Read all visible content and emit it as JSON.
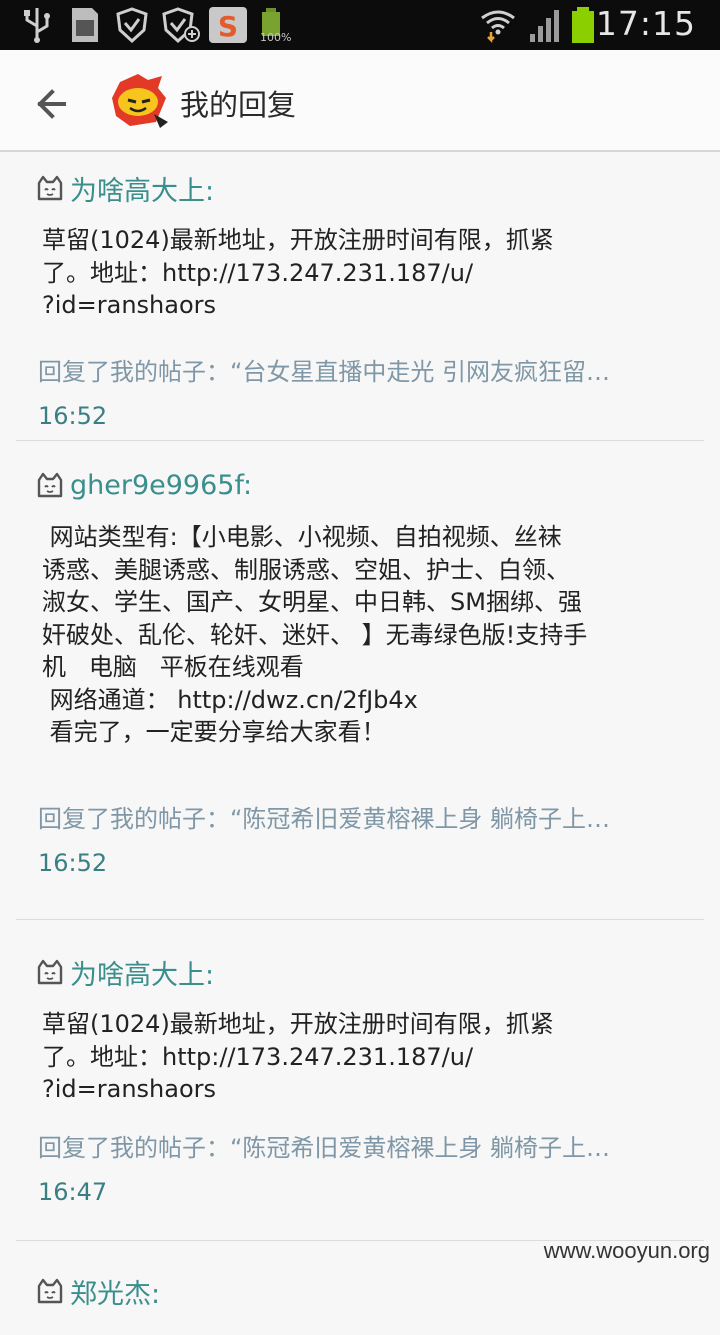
{
  "status_bar": {
    "time": "17:15",
    "battery_small_label": "100%",
    "icons": [
      "usb-icon",
      "sd-card-icon",
      "shield-icon",
      "shield-plus-icon",
      "sogou-input-icon",
      "battery-100-icon",
      "wifi-icon",
      "signal-icon",
      "battery-icon"
    ]
  },
  "action_bar": {
    "title": "我的回复",
    "back_icon": "arrow-left-icon",
    "logo_icon": "ninja-mascot-logo"
  },
  "replies": [
    {
      "author": "为啥高大上:",
      "content": "草留(1024)最新地址，开放注册时间有限，抓紧\n了。地址：http://173.247.231.187/u/\n?id=ranshaors",
      "replied_to": "回复了我的帖子：“台女星直播中走光 引网友疯狂留…",
      "time": "16:52"
    },
    {
      "author": "gher9e9965f:",
      "content": " 网站类型有:【小电影、小视频、自拍视频、丝袜\n诱惑、美腿诱惑、制服诱惑、空姐、护士、白领、\n淑女、学生、国产、女明星、中日韩、SM捆绑、强\n奸破处、乱伦、轮奸、迷奸、 】无毒绿色版!支持手\n机   电脑   平板在线观看\n 网络通道： http://dwz.cn/2fJb4x\n 看完了，一定要分享给大家看！\n ",
      "replied_to": "回复了我的帖子：“陈冠希旧爱黄榕裸上身 躺椅子上…",
      "time": "16:52"
    },
    {
      "author": "为啥高大上:",
      "content": "草留(1024)最新地址，开放注册时间有限，抓紧\n了。地址：http://173.247.231.187/u/\n?id=ranshaors",
      "replied_to": "回复了我的帖子：“陈冠希旧爱黄榕裸上身 躺椅子上…",
      "time": "16:47"
    },
    {
      "author": "郑光杰:",
      "content": "",
      "replied_to": "",
      "time": ""
    }
  ],
  "watermark": "www.wooyun.org"
}
